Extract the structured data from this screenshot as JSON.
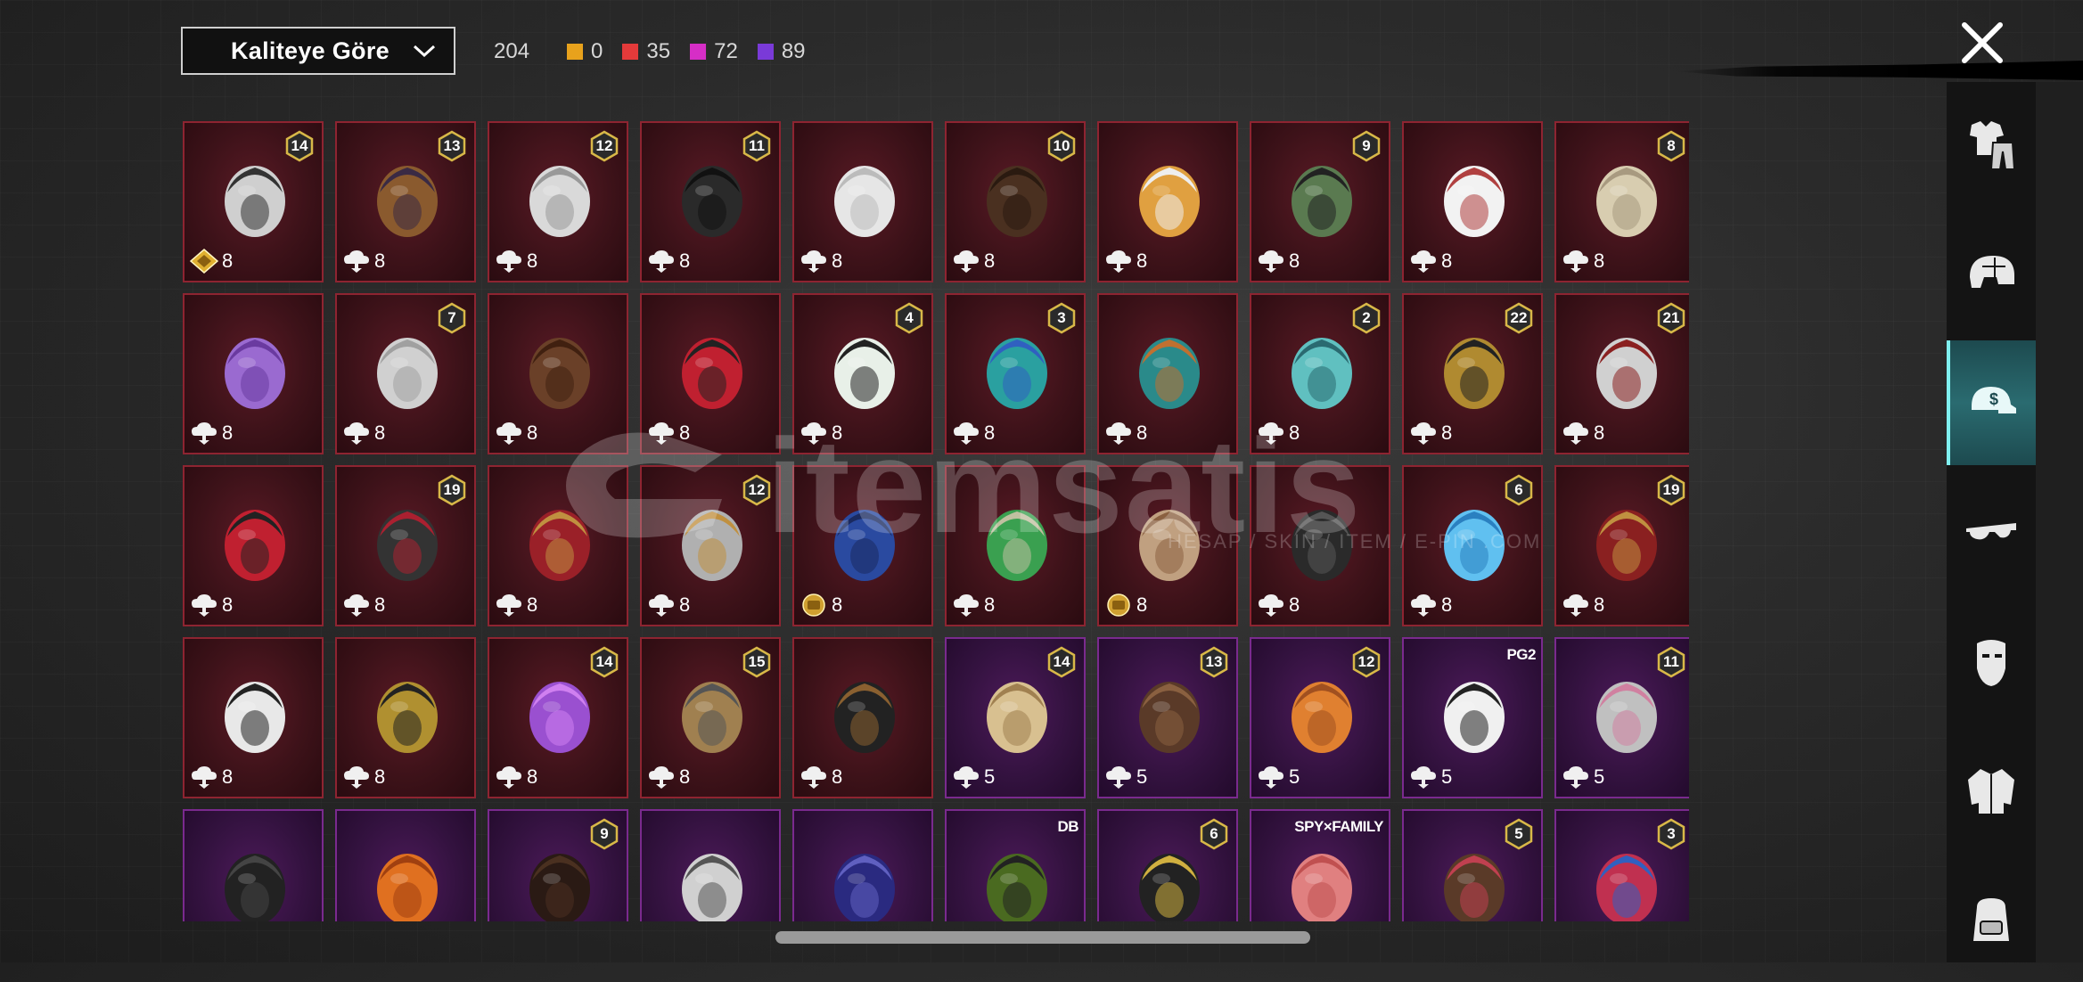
{
  "header": {
    "sort_label": "Kaliteye Göre",
    "total": "204",
    "counts": [
      {
        "value": "0",
        "color": "#e8a21c"
      },
      {
        "value": "35",
        "color": "#e43a3a"
      },
      {
        "value": "72",
        "color": "#d62ec6"
      },
      {
        "value": "89",
        "color": "#7a3ad8"
      }
    ]
  },
  "sidebar": {
    "items": [
      {
        "name": "outfit",
        "icon": "shirt-pants-icon"
      },
      {
        "name": "helmet",
        "icon": "helmet-icon"
      },
      {
        "name": "headwear",
        "icon": "cap-icon",
        "active": true
      },
      {
        "name": "eyewear",
        "icon": "glasses-icon"
      },
      {
        "name": "face",
        "icon": "mask-icon"
      },
      {
        "name": "top",
        "icon": "jacket-icon"
      },
      {
        "name": "backpack",
        "icon": "backpack-icon"
      }
    ]
  },
  "watermark": {
    "text": "itemsatis",
    "sub": "HESAP / SKIN / ITEM / E-PIN .COM"
  },
  "tiles": [
    {
      "badge": "14",
      "cost": "8",
      "currency": "gold-diamond-icon",
      "rarity": "red",
      "art": "cat-ear-hood-icon",
      "c1": "#cfcfcf",
      "c2": "#333"
    },
    {
      "badge": "13",
      "cost": "8",
      "currency": "cloud-coin-icon",
      "rarity": "red",
      "art": "witch-hat-hair-icon",
      "c1": "#8a5a2e",
      "c2": "#3a2a44"
    },
    {
      "badge": "12",
      "cost": "8",
      "currency": "cloud-coin-icon",
      "rarity": "red",
      "art": "white-curly-hair-icon",
      "c1": "#d9d9d9",
      "c2": "#999"
    },
    {
      "badge": "11",
      "cost": "8",
      "currency": "cloud-coin-icon",
      "rarity": "red",
      "art": "dark-helmet-icon",
      "c1": "#2a2a2a",
      "c2": "#111"
    },
    {
      "badge": "",
      "cost": "8",
      "currency": "cloud-coin-icon",
      "rarity": "red",
      "art": "white-long-hair-icon",
      "c1": "#e6e6e6",
      "c2": "#bbb"
    },
    {
      "badge": "10",
      "cost": "8",
      "currency": "cloud-coin-icon",
      "rarity": "red",
      "art": "brown-hair-icon",
      "c1": "#4a3020",
      "c2": "#2a1a10"
    },
    {
      "badge": "",
      "cost": "8",
      "currency": "cloud-coin-icon",
      "rarity": "red",
      "art": "skull-mask-hair-icon",
      "c1": "#e0a040",
      "c2": "#eee"
    },
    {
      "badge": "9",
      "cost": "8",
      "currency": "cloud-coin-icon",
      "rarity": "red",
      "art": "zombie-head-icon",
      "c1": "#5a7a50",
      "c2": "#222"
    },
    {
      "badge": "",
      "cost": "8",
      "currency": "cloud-coin-icon",
      "rarity": "red",
      "art": "cowboy-hat-icon",
      "c1": "#f2f2f2",
      "c2": "#b04040"
    },
    {
      "badge": "8",
      "cost": "8",
      "currency": "cloud-coin-icon",
      "rarity": "red",
      "art": "blonde-bob-hair-icon",
      "c1": "#d8cdb0",
      "c2": "#a89a80"
    },
    {
      "badge": "",
      "cost": "8",
      "currency": "cloud-coin-icon",
      "rarity": "red",
      "art": "purple-ponytail-icon",
      "c1": "#9a6ad0",
      "c2": "#6a3aa0"
    },
    {
      "badge": "7",
      "cost": "8",
      "currency": "cloud-coin-icon",
      "rarity": "red",
      "art": "silver-long-hair-icon",
      "c1": "#d0d0d0",
      "c2": "#a0a0a0"
    },
    {
      "badge": "",
      "cost": "8",
      "currency": "cloud-coin-icon",
      "rarity": "red",
      "art": "fox-ear-hair-icon",
      "c1": "#6a4028",
      "c2": "#402010"
    },
    {
      "badge": "",
      "cost": "8",
      "currency": "cloud-coin-icon",
      "rarity": "red",
      "art": "red-helmet-icon",
      "c1": "#c02030",
      "c2": "#222"
    },
    {
      "badge": "4",
      "cost": "8",
      "currency": "cloud-coin-icon",
      "rarity": "red",
      "art": "snowman-hat-icon",
      "c1": "#e8f0e8",
      "c2": "#222"
    },
    {
      "badge": "3",
      "cost": "8",
      "currency": "cloud-coin-icon",
      "rarity": "red",
      "art": "joker-green-hair-icon",
      "c1": "#2aa0a0",
      "c2": "#3060c0"
    },
    {
      "badge": "",
      "cost": "8",
      "currency": "cloud-coin-icon",
      "rarity": "red",
      "art": "teal-armor-helmet-icon",
      "c1": "#2a8a8a",
      "c2": "#c07030"
    },
    {
      "badge": "2",
      "cost": "8",
      "currency": "cloud-coin-icon",
      "rarity": "red",
      "art": "teal-hood-icon",
      "c1": "#60c0c0",
      "c2": "#2a6a70"
    },
    {
      "badge": "22",
      "cost": "8",
      "currency": "cloud-coin-icon",
      "rarity": "red",
      "art": "gold-helmet-icon",
      "c1": "#b08a30",
      "c2": "#222"
    },
    {
      "badge": "21",
      "cost": "8",
      "currency": "cloud-coin-icon",
      "rarity": "red",
      "art": "clown-mask-icon",
      "c1": "#d0d0d0",
      "c2": "#8a2020"
    },
    {
      "badge": "",
      "cost": "8",
      "currency": "cloud-coin-icon",
      "rarity": "red",
      "art": "demon-mask-icon",
      "c1": "#c02030",
      "c2": "#222"
    },
    {
      "badge": "19",
      "cost": "8",
      "currency": "cloud-coin-icon",
      "rarity": "red",
      "art": "black-helmet-icon",
      "c1": "#333",
      "c2": "#aa2030"
    },
    {
      "badge": "",
      "cost": "8",
      "currency": "cloud-coin-icon",
      "rarity": "red",
      "art": "crimson-helmet-icon",
      "c1": "#9a2028",
      "c2": "#c09040"
    },
    {
      "badge": "12",
      "cost": "8",
      "currency": "cloud-coin-icon",
      "rarity": "red",
      "art": "silver-armor-helmet-icon",
      "c1": "#b0b0b0",
      "c2": "#c09040"
    },
    {
      "badge": "",
      "cost": "8",
      "currency": "gold-token-icon",
      "rarity": "red",
      "art": "blue-feather-icon",
      "c1": "#2a4aa0",
      "c2": "#1a2a60"
    },
    {
      "badge": "",
      "cost": "8",
      "currency": "cloud-coin-icon",
      "rarity": "red",
      "art": "green-spike-helmet-icon",
      "c1": "#3aa050",
      "c2": "#c0c0a0"
    },
    {
      "badge": "",
      "cost": "8",
      "currency": "gold-token-icon",
      "rarity": "red",
      "art": "bun-hair-icon",
      "c1": "#c0a080",
      "c2": "#8a6040"
    },
    {
      "badge": "",
      "cost": "8",
      "currency": "cloud-coin-icon",
      "rarity": "red",
      "art": "ninja-helmet-icon",
      "c1": "#2a2a2a",
      "c2": "#555"
    },
    {
      "badge": "6",
      "cost": "8",
      "currency": "cloud-coin-icon",
      "rarity": "red",
      "art": "ice-armor-icon",
      "c1": "#60c0f0",
      "c2": "#2a80c0"
    },
    {
      "badge": "19",
      "cost": "8",
      "currency": "cloud-coin-icon",
      "rarity": "red",
      "art": "samurai-helmet-icon",
      "c1": "#8a2020",
      "c2": "#c09040"
    },
    {
      "badge": "",
      "cost": "8",
      "currency": "cloud-coin-icon",
      "rarity": "red",
      "art": "ghost-sheet-icon",
      "c1": "#e8e8e8",
      "c2": "#222"
    },
    {
      "badge": "",
      "cost": "8",
      "currency": "cloud-coin-icon",
      "rarity": "red",
      "art": "pharaoh-helmet-icon",
      "c1": "#b09030",
      "c2": "#222"
    },
    {
      "badge": "14",
      "cost": "8",
      "currency": "cloud-coin-icon",
      "rarity": "red",
      "art": "purple-curly-hair-icon",
      "c1": "#9a50d0",
      "c2": "#d080f0"
    },
    {
      "badge": "15",
      "cost": "8",
      "currency": "cloud-coin-icon",
      "rarity": "red",
      "art": "braid-helmet-icon",
      "c1": "#a08050",
      "c2": "#555"
    },
    {
      "badge": "",
      "cost": "8",
      "currency": "cloud-coin-icon",
      "rarity": "red",
      "art": "pirate-hat-icon",
      "c1": "#222",
      "c2": "#8a6030"
    },
    {
      "badge": "14",
      "cost": "5",
      "currency": "cloud-coin-icon",
      "rarity": "purple",
      "art": "blonde-flower-hair-icon",
      "c1": "#d8c090",
      "c2": "#a08050"
    },
    {
      "badge": "13",
      "cost": "5",
      "currency": "cloud-coin-icon",
      "rarity": "purple",
      "art": "goggles-hair-icon",
      "c1": "#5a3a28",
      "c2": "#8a6040"
    },
    {
      "badge": "12",
      "cost": "5",
      "currency": "cloud-coin-icon",
      "rarity": "purple",
      "art": "orange-twin-tails-icon",
      "c1": "#e08030",
      "c2": "#a05020"
    },
    {
      "badge": "",
      "cost": "5",
      "currency": "cloud-coin-icon",
      "rarity": "purple",
      "art": "panda-head-icon",
      "c1": "#f0f0f0",
      "c2": "#222",
      "tag": "PG2"
    },
    {
      "badge": "11",
      "cost": "5",
      "currency": "cloud-coin-icon",
      "rarity": "purple",
      "art": "flower-crown-hair-icon",
      "c1": "#c0c0c0",
      "c2": "#d080a0"
    },
    {
      "badge": "",
      "cost": "",
      "currency": "",
      "rarity": "purple",
      "art": "black-balaclava-icon",
      "c1": "#222",
      "c2": "#444"
    },
    {
      "badge": "",
      "cost": "",
      "currency": "",
      "rarity": "purple",
      "art": "pumpkin-head-icon",
      "c1": "#e07020",
      "c2": "#a04010"
    },
    {
      "badge": "9",
      "cost": "",
      "currency": "",
      "rarity": "purple",
      "art": "dark-long-hair-icon",
      "c1": "#2a1a14",
      "c2": "#4a3020"
    },
    {
      "badge": "",
      "cost": "",
      "currency": "",
      "rarity": "purple",
      "art": "silver-hood-icon",
      "c1": "#d0d0d0",
      "c2": "#555"
    },
    {
      "badge": "",
      "cost": "",
      "currency": "",
      "rarity": "purple",
      "art": "blue-space-helmet-icon",
      "c1": "#2a2a80",
      "c2": "#6060c0"
    },
    {
      "badge": "",
      "cost": "",
      "currency": "",
      "rarity": "purple",
      "art": "green-cap-hair-icon",
      "c1": "#4a6a20",
      "c2": "#222",
      "tag": "DB"
    },
    {
      "badge": "6",
      "cost": "",
      "currency": "",
      "rarity": "purple",
      "art": "gold-mask-hair-icon",
      "c1": "#222",
      "c2": "#d0b040"
    },
    {
      "badge": "",
      "cost": "",
      "currency": "",
      "rarity": "purple",
      "art": "pink-hair-icon",
      "c1": "#e08080",
      "c2": "#c05050",
      "tag": "SPY×FAMILY"
    },
    {
      "badge": "5",
      "cost": "",
      "currency": "",
      "rarity": "purple",
      "art": "bow-brown-hair-icon",
      "c1": "#5a3a28",
      "c2": "#c04050"
    },
    {
      "badge": "3",
      "cost": "",
      "currency": "",
      "rarity": "purple",
      "art": "jester-hat-icon",
      "c1": "#c03050",
      "c2": "#3060c0"
    }
  ]
}
